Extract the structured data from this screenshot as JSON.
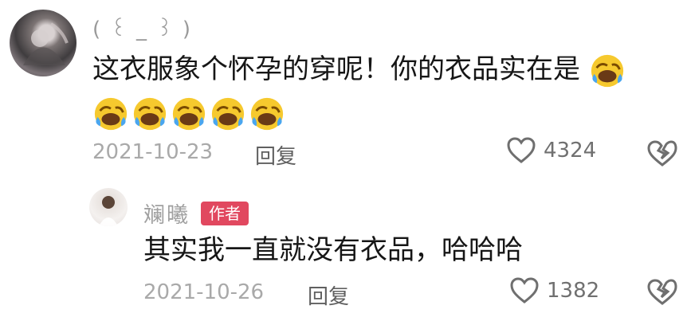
{
  "comment": {
    "username": "( ꒰ _ ꒱ )",
    "text": "这衣服象个怀孕的穿呢！你的衣品实在是",
    "emoji_name": "laughing-crying-emoji",
    "date": "2021-10-23",
    "reply_label": "回复",
    "likes": "4324"
  },
  "reply": {
    "username": "斓曦",
    "badge": "作者",
    "text": "其实我一直就没有衣品，哈哈哈",
    "date": "2021-10-26",
    "reply_label": "回复",
    "likes": "1382"
  },
  "colors": {
    "badge": "#e1485f",
    "muted_text": "#a9a9a9"
  }
}
